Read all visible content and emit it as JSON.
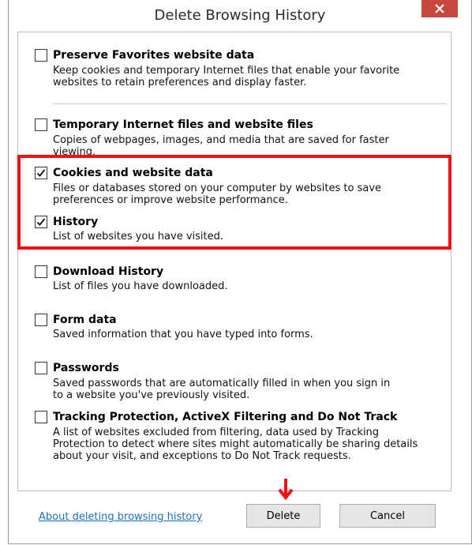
{
  "window": {
    "title": "Delete Browsing History"
  },
  "colors": {
    "highlight": "#ee1111",
    "link": "#1a6fc0",
    "close_button": "#c7463f"
  },
  "options": [
    {
      "key": "preserve_favorites",
      "label": "Preserve Favorites website data",
      "description": "Keep cookies and temporary Internet files that enable your favorite\nwebsites to retain preferences and display faster.",
      "checked": false
    },
    {
      "key": "temp_files",
      "label": "Temporary Internet files and website files",
      "description": "Copies of webpages, images, and media that are saved for faster\nviewing.",
      "checked": false
    },
    {
      "key": "cookies",
      "label": "Cookies and website data",
      "description": "Files or databases stored on your computer by websites to save\npreferences or improve website performance.",
      "checked": true
    },
    {
      "key": "history",
      "label": "History",
      "description": "List of websites you have visited.",
      "checked": true
    },
    {
      "key": "download_history",
      "label": "Download History",
      "description": "List of files you have downloaded.",
      "checked": false
    },
    {
      "key": "form_data",
      "label": "Form data",
      "description": "Saved information that you have typed into forms.",
      "checked": false
    },
    {
      "key": "passwords",
      "label": "Passwords",
      "description": "Saved passwords that are automatically filled in when you sign in\nto a website you've previously visited.",
      "checked": false
    },
    {
      "key": "tracking_protection",
      "label": "Tracking Protection, ActiveX Filtering and Do Not Track",
      "description": "A list of websites excluded from filtering, data used by Tracking\nProtection to detect where sites might automatically be sharing details\nabout your visit, and exceptions to Do Not Track requests.",
      "checked": false
    }
  ],
  "footer": {
    "about_link": "About deleting browsing history",
    "delete_label": "Delete",
    "cancel_label": "Cancel"
  },
  "icons": {
    "close": "close-x-icon",
    "check": "checkmark-icon",
    "arrow": "down-arrow-annotation-icon"
  }
}
